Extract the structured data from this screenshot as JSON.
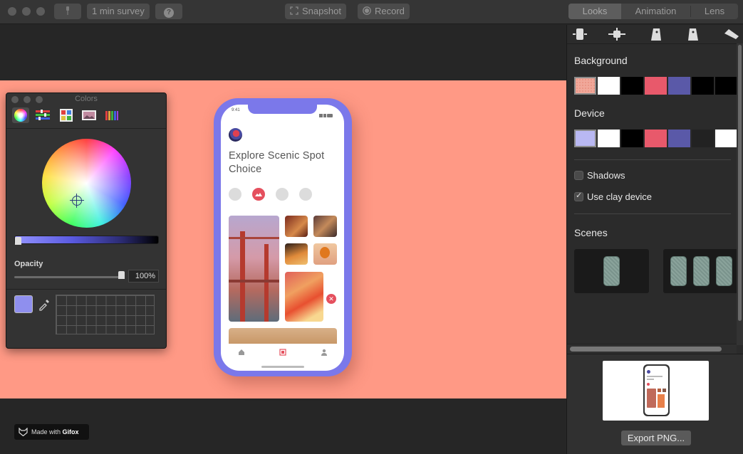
{
  "toolbar": {
    "survey_label": "1 min survey",
    "help_label": "?",
    "snapshot_label": "Snapshot",
    "record_label": "Record",
    "tabs": [
      {
        "label": "Looks",
        "active": true
      },
      {
        "label": "Animation",
        "active": false
      },
      {
        "label": "Lens",
        "active": false
      }
    ]
  },
  "colors_panel": {
    "title": "Colors",
    "mode_icons": [
      "color-wheel-icon",
      "color-sliders-icon",
      "color-palettes-icon",
      "image-palettes-icon",
      "crayons-icon"
    ],
    "opacity_label": "Opacity",
    "opacity_value": "100%",
    "opacity_fraction": 1.0,
    "current_color": "#8f8fee"
  },
  "phone": {
    "status_time": "9:41",
    "title_line1": "Explore Scenic Spot",
    "title_line2": "Choice",
    "close_symbol": "✕",
    "tabs": [
      "home-icon",
      "gallery-icon",
      "profile-icon"
    ]
  },
  "gifox": {
    "made_with": "Made with ",
    "brand": "Gifox"
  },
  "right_panel": {
    "icon_tabs": [
      "device-front-icon",
      "device-center-icon",
      "device-tilt-left-icon",
      "device-tilt-right-icon",
      "device-flat-icon"
    ],
    "background_label": "Background",
    "background_swatches": [
      "#f0a89a",
      "#ffffff",
      "#000000",
      "#e8596b",
      "#5a59a8",
      "#000000",
      "#000000"
    ],
    "device_label": "Device",
    "device_swatches": [
      "#b9b8f2",
      "#ffffff",
      "#000000",
      "#e8596b",
      "#5a59a8",
      "#222222",
      "#ffffff"
    ],
    "shadows_label": "Shadows",
    "shadows_checked": false,
    "clay_label": "Use clay device",
    "clay_checked": true,
    "scenes_label": "Scenes",
    "export_label": "Export PNG..."
  },
  "colors": {
    "canvas_band": "#ff9985",
    "device": "#7b78ea",
    "accent": "#e5505e"
  }
}
